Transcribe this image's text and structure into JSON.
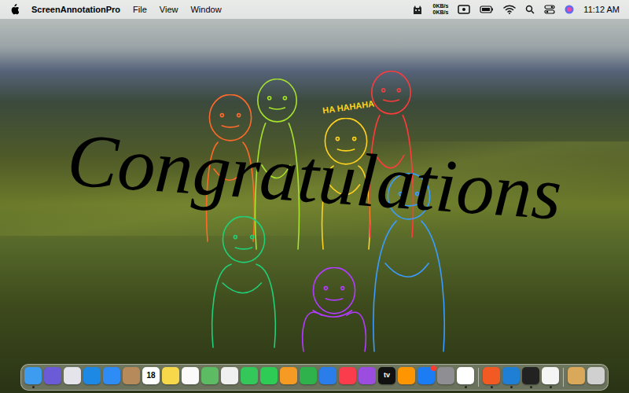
{
  "menu_bar": {
    "app_name": "ScreenAnnotationPro",
    "menus": [
      "File",
      "View",
      "Window"
    ],
    "network": {
      "up": "0KB/s",
      "down": "0KB/s"
    },
    "time": "11:12 AM"
  },
  "annotations": {
    "caption": "Congratulations",
    "speech": "HA HAHAHA",
    "figures": [
      {
        "color": "#ff6a2a"
      },
      {
        "color": "#a6e22e"
      },
      {
        "color": "#ffd21f"
      },
      {
        "color": "#ff3b3b"
      },
      {
        "color": "#1fd07a"
      },
      {
        "color": "#3a9cff"
      },
      {
        "color": "#b23cff"
      }
    ]
  },
  "dock": {
    "items": [
      {
        "kind": "app",
        "color": "#3d9cf0",
        "running": true,
        "text": "",
        "badge": false
      },
      {
        "kind": "app",
        "color": "#6b5bd6",
        "running": false,
        "text": "",
        "badge": false
      },
      {
        "kind": "app",
        "color": "#e4e4ea",
        "running": false,
        "text": "",
        "badge": false
      },
      {
        "kind": "app",
        "color": "#1e88e5",
        "running": false,
        "text": "",
        "badge": false
      },
      {
        "kind": "app",
        "color": "#2f8cf5",
        "running": false,
        "text": "",
        "badge": false
      },
      {
        "kind": "app",
        "color": "#b78a5c",
        "running": false,
        "text": "",
        "badge": false
      },
      {
        "kind": "app",
        "color": "#ffffff",
        "running": false,
        "text": "18",
        "badge": false
      },
      {
        "kind": "app",
        "color": "#f7d84a",
        "running": false,
        "text": "",
        "badge": false
      },
      {
        "kind": "app",
        "color": "#fafafa",
        "running": false,
        "text": "",
        "badge": false
      },
      {
        "kind": "app",
        "color": "#5dbb63",
        "running": false,
        "text": "",
        "badge": false
      },
      {
        "kind": "app",
        "color": "#f0f0f0",
        "running": false,
        "text": "",
        "badge": false
      },
      {
        "kind": "app",
        "color": "#34c759",
        "running": false,
        "text": "",
        "badge": false
      },
      {
        "kind": "app",
        "color": "#2ecc55",
        "running": false,
        "text": "",
        "badge": false
      },
      {
        "kind": "app",
        "color": "#f59a23",
        "running": false,
        "text": "",
        "badge": false
      },
      {
        "kind": "app",
        "color": "#2fb24c",
        "running": false,
        "text": "",
        "badge": false
      },
      {
        "kind": "app",
        "color": "#2b7de9",
        "running": false,
        "text": "",
        "badge": false
      },
      {
        "kind": "app",
        "color": "#fa3c4c",
        "running": false,
        "text": "",
        "badge": false
      },
      {
        "kind": "app",
        "color": "#9b4de0",
        "running": false,
        "text": "",
        "badge": false
      },
      {
        "kind": "app",
        "color": "#111111",
        "running": false,
        "text": "tv",
        "badge": false
      },
      {
        "kind": "app",
        "color": "#ff9500",
        "running": false,
        "text": "",
        "badge": false
      },
      {
        "kind": "app",
        "color": "#1c7cf4",
        "running": false,
        "text": "",
        "badge": true
      },
      {
        "kind": "app",
        "color": "#8e8e93",
        "running": false,
        "text": "",
        "badge": false
      },
      {
        "kind": "app",
        "color": "#ffffff",
        "running": true,
        "text": "",
        "badge": false
      },
      {
        "kind": "separator"
      },
      {
        "kind": "app",
        "color": "#f25a24",
        "running": true,
        "text": "",
        "badge": false
      },
      {
        "kind": "app",
        "color": "#1f7fd4",
        "running": true,
        "text": "",
        "badge": false
      },
      {
        "kind": "app",
        "color": "#222222",
        "running": true,
        "text": "",
        "badge": false
      },
      {
        "kind": "app",
        "color": "#f5f5f5",
        "running": true,
        "text": "",
        "badge": false
      },
      {
        "kind": "separator"
      },
      {
        "kind": "app",
        "color": "#d9a85b",
        "running": false,
        "text": "",
        "badge": false
      },
      {
        "kind": "app",
        "color": "#d0d0d0",
        "running": false,
        "text": "",
        "badge": false
      }
    ]
  }
}
